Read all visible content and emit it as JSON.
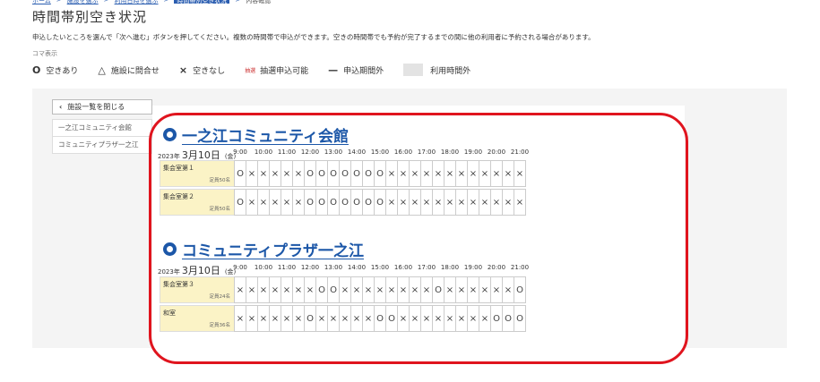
{
  "breadcrumb": [
    {
      "label": "ホーム",
      "kind": "link"
    },
    {
      "label": "施設を選ぶ",
      "kind": "link"
    },
    {
      "label": "利用日時を選ぶ",
      "kind": "link"
    },
    {
      "label": "時間帯別空き状況",
      "kind": "current"
    },
    {
      "label": "内容確認",
      "kind": "plain"
    }
  ],
  "page_title": "時間帯別空き状況",
  "instruction": "申込したいところを選んで「次へ進む」ボタンを押してください。複数の時間帯で申込ができます。空きの時間帯でも予約が完了するまでの間に他の利用者に予約される場合があります。",
  "koma_label": "コマ表示",
  "legend": {
    "available": {
      "symbol": "O",
      "label": "空きあり"
    },
    "inquire": {
      "symbol": "△",
      "label": "施設に問合せ"
    },
    "unavailable": {
      "symbol": "×",
      "label": "空きなし"
    },
    "lottery": {
      "tag": "抽選",
      "label": "抽選申込可能"
    },
    "out_of_period": {
      "symbol": "—",
      "label": "申込期間外"
    },
    "out_of_hours": {
      "label": "利用時間外"
    }
  },
  "close_button_label": "施設一覧を閉じる",
  "facility_list": [
    "一之江コミュニティ会館",
    "コミュニティプラザ一之江"
  ],
  "hours": [
    "9:00",
    "10:00",
    "11:00",
    "12:00",
    "13:00",
    "14:00",
    "15:00",
    "16:00",
    "17:00",
    "18:00",
    "19:00",
    "20:00",
    "21:00"
  ],
  "facilities": [
    {
      "name": "一之江コミュニティ会館",
      "date": {
        "year": "2023年",
        "md": "3月10日",
        "weekday": "金"
      },
      "rooms": [
        {
          "name": "集会室第１",
          "capacity": "定員50名",
          "slots": [
            "O",
            "×",
            "×",
            "×",
            "×",
            "×",
            "O",
            "O",
            "O",
            "O",
            "O",
            "O",
            "O",
            "×",
            "×",
            "×",
            "×",
            "×",
            "×",
            "×",
            "×",
            "×",
            "×",
            "×",
            "×"
          ]
        },
        {
          "name": "集会室第２",
          "capacity": "定員50名",
          "slots": [
            "O",
            "×",
            "×",
            "×",
            "×",
            "×",
            "O",
            "O",
            "O",
            "O",
            "O",
            "O",
            "O",
            "×",
            "×",
            "×",
            "×",
            "×",
            "×",
            "×",
            "×",
            "×",
            "×",
            "×",
            "×"
          ]
        }
      ]
    },
    {
      "name": "コミュニティプラザ一之江",
      "date": {
        "year": "2023年",
        "md": "3月10日",
        "weekday": "金"
      },
      "rooms": [
        {
          "name": "集会室第３",
          "capacity": "定員24名",
          "slots": [
            "×",
            "×",
            "×",
            "×",
            "×",
            "×",
            "×",
            "O",
            "O",
            "×",
            "×",
            "×",
            "×",
            "×",
            "×",
            "×",
            "×",
            "O",
            "×",
            "×",
            "×",
            "×",
            "×",
            "×",
            "O"
          ]
        },
        {
          "name": "和室",
          "capacity": "定員36名",
          "slots": [
            "×",
            "×",
            "×",
            "×",
            "×",
            "×",
            "O",
            "×",
            "×",
            "×",
            "×",
            "×",
            "O",
            "O",
            "×",
            "×",
            "×",
            "×",
            "×",
            "×",
            "×",
            "×",
            "O",
            "O",
            "O"
          ]
        }
      ]
    }
  ],
  "colors": {
    "accent": "#1c57a8",
    "highlight": "#e0141e",
    "room_bg": "#fbf3c6"
  }
}
